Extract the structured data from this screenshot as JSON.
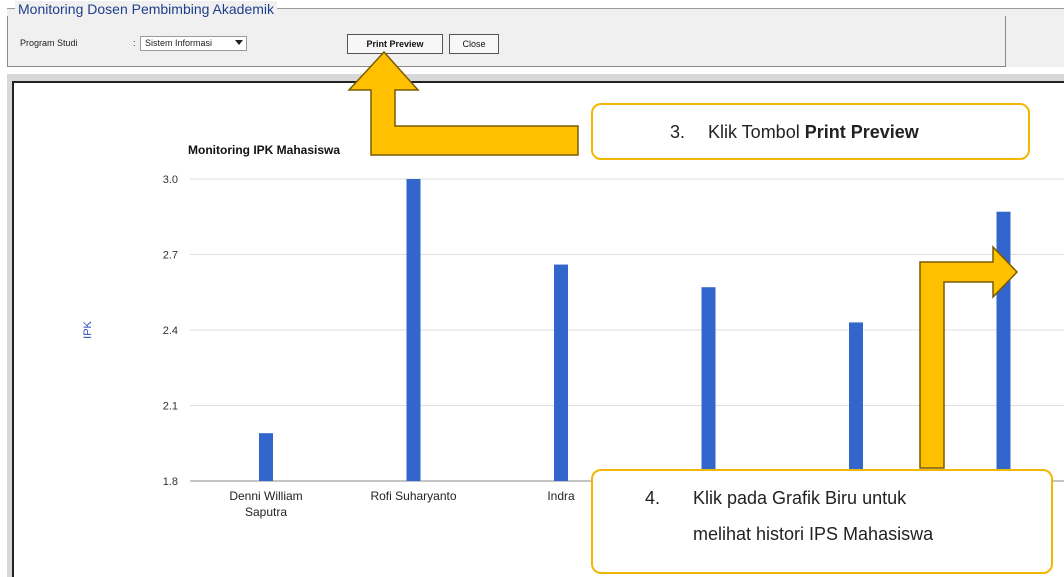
{
  "panel": {
    "title": "Monitoring Dosen Pembimbing Akademik",
    "program_label": "Program Studi",
    "program_sep": ":",
    "program_value": "Sistem Informasi",
    "print_preview_label": "Print Preview",
    "close_label": "Close"
  },
  "callouts": {
    "step3_number": "3.",
    "step3_prefix": "Klik Tombol ",
    "step3_bold": "Print Preview",
    "step4_number": "4.",
    "step4_line1": "Klik pada Grafik Biru untuk",
    "step4_line2": "melihat histori IPS Mahasiswa"
  },
  "colors": {
    "bar": "#3366cc",
    "arrow_fill": "#ffc000",
    "arrow_stroke": "#7a5a00",
    "callout_border": "#f2b705",
    "title_blue": "#1f3e8c"
  },
  "chart_data": {
    "type": "bar",
    "title": "Monitoring IPK Mahasiswa",
    "ylabel": "IPK",
    "ylim": [
      1.8,
      3.0
    ],
    "yticks": [
      "3.0",
      "2.7",
      "2.4",
      "2.1",
      "1.8"
    ],
    "categories": [
      {
        "line1": "Denni William",
        "line2": "Saputra"
      },
      {
        "line1": "Rofi Suharyanto",
        "line2": ""
      },
      {
        "line1": "Indra",
        "line2": ""
      },
      {
        "line1": "",
        "line2": ""
      },
      {
        "line1": "",
        "line2": ""
      },
      {
        "line1": "",
        "line2": ""
      }
    ],
    "values": [
      1.99,
      3.0,
      2.66,
      2.57,
      2.43,
      2.87
    ],
    "grid": true,
    "legend": "none"
  }
}
